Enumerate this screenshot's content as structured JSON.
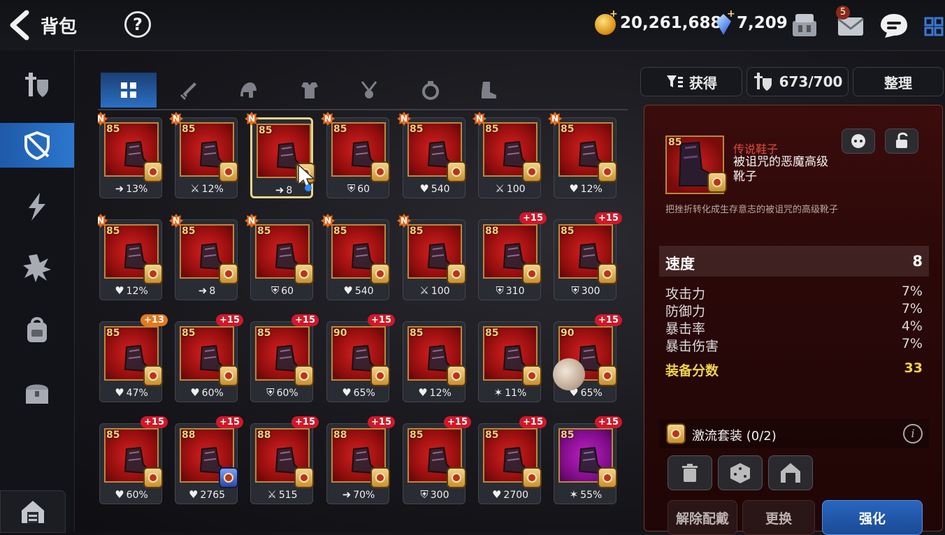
{
  "header": {
    "title": "背包",
    "help": "?",
    "gold": "20,261,688",
    "gems": "7,209",
    "mail_count": "5"
  },
  "filters": {
    "sort_label": "获得",
    "capacity": "673/700",
    "organize_label": "整理"
  },
  "items": [
    {
      "level": "85",
      "badge": "N",
      "stat_icon": "speed",
      "stat": "13%"
    },
    {
      "level": "85",
      "badge": "N",
      "stat_icon": "attack",
      "stat": "12%"
    },
    {
      "level": "85",
      "badge": "N",
      "stat_icon": "speed",
      "stat": "8",
      "selected": true
    },
    {
      "level": "85",
      "badge": "N",
      "stat_icon": "defense",
      "stat": "60"
    },
    {
      "level": "85",
      "badge": "N",
      "stat_icon": "health",
      "stat": "540"
    },
    {
      "level": "85",
      "badge": "N",
      "stat_icon": "attack",
      "stat": "100"
    },
    {
      "level": "85",
      "badge": "N",
      "stat_icon": "health",
      "stat": "12%"
    },
    {
      "level": "85",
      "badge": "N",
      "stat_icon": "health",
      "stat": "12%"
    },
    {
      "level": "85",
      "badge": "N",
      "stat_icon": "speed",
      "stat": "8"
    },
    {
      "level": "85",
      "badge": "N",
      "stat_icon": "defense",
      "stat": "60"
    },
    {
      "level": "85",
      "badge": "N",
      "stat_icon": "health",
      "stat": "540"
    },
    {
      "level": "85",
      "badge": "N",
      "stat_icon": "attack",
      "stat": "100"
    },
    {
      "level": "88",
      "badge": "+15",
      "stat_icon": "defense",
      "stat": "310"
    },
    {
      "level": "85",
      "badge": "+15",
      "stat_icon": "defense",
      "stat": "300"
    },
    {
      "level": "85",
      "badge": "+13",
      "stat_icon": "health",
      "stat": "47%"
    },
    {
      "level": "85",
      "badge": "+15",
      "stat_icon": "health",
      "stat": "60%"
    },
    {
      "level": "85",
      "badge": "+15",
      "stat_icon": "defense",
      "stat": "60%"
    },
    {
      "level": "90",
      "badge": "+15",
      "stat_icon": "health",
      "stat": "65%"
    },
    {
      "level": "85",
      "badge": "",
      "stat_icon": "health",
      "stat": "12%"
    },
    {
      "level": "85",
      "badge": "",
      "stat_icon": "crit",
      "stat": "11%"
    },
    {
      "level": "90",
      "badge": "+15",
      "stat_icon": "health",
      "stat": "65%"
    },
    {
      "level": "85",
      "badge": "+15",
      "stat_icon": "health",
      "stat": "60%"
    },
    {
      "level": "88",
      "badge": "+15",
      "stat_icon": "health",
      "stat": "2765"
    },
    {
      "level": "88",
      "badge": "+15",
      "stat_icon": "attack",
      "stat": "515"
    },
    {
      "level": "88",
      "badge": "+15",
      "stat_icon": "speed",
      "stat": "70%"
    },
    {
      "level": "85",
      "badge": "+15",
      "stat_icon": "defense",
      "stat": "300"
    },
    {
      "level": "85",
      "badge": "+15",
      "stat_icon": "health",
      "stat": "2700"
    },
    {
      "level": "85",
      "badge": "+15",
      "stat_icon": "crit",
      "stat": "55%"
    }
  ],
  "detail": {
    "rarity": "传说鞋子",
    "name": "被诅咒的恶魔高级靴子",
    "description": "把挫折转化成生存意志的被诅咒的高级靴子",
    "level": "85",
    "main_stat": {
      "label": "速度",
      "value": "8"
    },
    "sub_stats": [
      {
        "label": "攻击力",
        "value": "7%"
      },
      {
        "label": "防御力",
        "value": "7%"
      },
      {
        "label": "暴击率",
        "value": "4%"
      },
      {
        "label": "暴击伤害",
        "value": "7%"
      }
    ],
    "score": {
      "label": "装备分数",
      "value": "33"
    },
    "set": "激流套装 (0/2)",
    "buttons": {
      "unequip": "解除配戴",
      "swap": "更换",
      "enhance": "强化"
    }
  },
  "colors": {
    "accent": "#2b6fc4",
    "rare_red": "#e04a3a",
    "score": "#f0d44a"
  }
}
